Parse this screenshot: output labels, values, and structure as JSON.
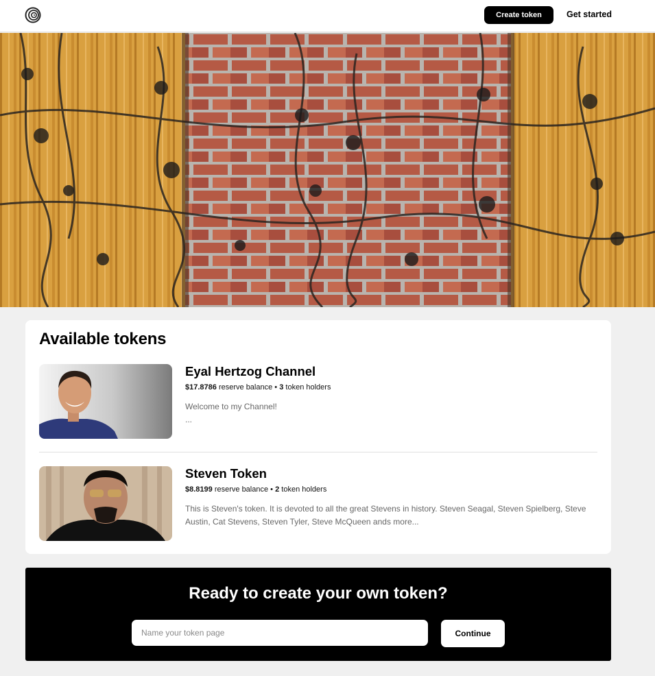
{
  "header": {
    "logo_icon": "spiral-logo-icon",
    "create_token_label": "Create token",
    "get_started_label": "Get started"
  },
  "main": {
    "heading": "Available tokens",
    "tokens": [
      {
        "name": "Eyal Hertzog Channel",
        "reserve_value": "$17.8786",
        "reserve_label": "reserve balance",
        "holders_count": "3",
        "holders_label": "token holders",
        "description": "Welcome to my Channel!",
        "more": "..."
      },
      {
        "name": "Steven Token",
        "reserve_value": "$8.8199",
        "reserve_label": "reserve balance",
        "holders_count": "2",
        "holders_label": "token holders",
        "description": "This is Steven's token. It is devoted to all the great Stevens in history. Steven Seagal, Steven Spielberg, Steve Austin, Cat Stevens, Steven Tyler, Steve McQueen ands more..."
      }
    ]
  },
  "cta": {
    "heading": "Ready to create your own token?",
    "input_placeholder": "Name your token page",
    "continue_label": "Continue"
  },
  "colors": {
    "accent": "#000000",
    "background": "#f0f0f0"
  }
}
